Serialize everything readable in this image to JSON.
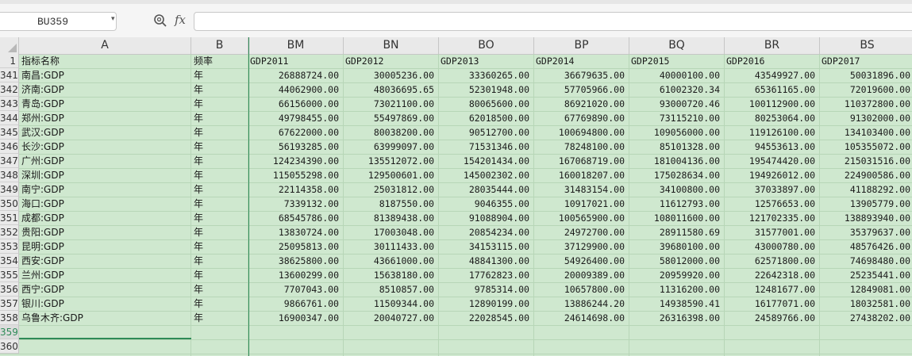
{
  "formula_bar": {
    "name_box": "BU359",
    "fx_label": "fx",
    "formula": ""
  },
  "columns": [
    {
      "id": "A",
      "label": "A",
      "width": 217
    },
    {
      "id": "B",
      "label": "B",
      "width": 72
    },
    {
      "id": "BM",
      "label": "BM",
      "width": 120
    },
    {
      "id": "BN",
      "label": "BN",
      "width": 120
    },
    {
      "id": "BO",
      "label": "BO",
      "width": 120
    },
    {
      "id": "BP",
      "label": "BP",
      "width": 120
    },
    {
      "id": "BQ",
      "label": "BQ",
      "width": 120
    },
    {
      "id": "BR",
      "label": "BR",
      "width": 120
    },
    {
      "id": "BS",
      "label": "BS",
      "width": 120
    }
  ],
  "header_row": {
    "num": "1",
    "cells": [
      "指标名称",
      "频率",
      "GDP2011",
      "GDP2012",
      "GDP2013",
      "GDP2014",
      "GDP2015",
      "GDP2016",
      "GDP2017"
    ]
  },
  "rows": [
    {
      "num": "341",
      "cells": [
        "南昌:GDP",
        "年",
        "26888724.00",
        "30005236.00",
        "33360265.00",
        "36679635.00",
        "40000100.00",
        "43549927.00",
        "50031896.00"
      ]
    },
    {
      "num": "342",
      "cells": [
        "济南:GDP",
        "年",
        "44062900.00",
        "48036695.65",
        "52301948.00",
        "57705966.00",
        "61002320.34",
        "65361165.00",
        "72019600.00"
      ]
    },
    {
      "num": "343",
      "cells": [
        "青岛:GDP",
        "年",
        "66156000.00",
        "73021100.00",
        "80065600.00",
        "86921020.00",
        "93000720.46",
        "100112900.00",
        "110372800.00"
      ]
    },
    {
      "num": "344",
      "cells": [
        "郑州:GDP",
        "年",
        "49798455.00",
        "55497869.00",
        "62018500.00",
        "67769890.00",
        "73115210.00",
        "80253064.00",
        "91302000.00"
      ]
    },
    {
      "num": "345",
      "cells": [
        "武汉:GDP",
        "年",
        "67622000.00",
        "80038200.00",
        "90512700.00",
        "100694800.00",
        "109056000.00",
        "119126100.00",
        "134103400.00"
      ]
    },
    {
      "num": "346",
      "cells": [
        "长沙:GDP",
        "年",
        "56193285.00",
        "63999097.00",
        "71531346.00",
        "78248100.00",
        "85101328.00",
        "94553613.00",
        "105355072.00"
      ]
    },
    {
      "num": "347",
      "cells": [
        "广州:GDP",
        "年",
        "124234390.00",
        "135512072.00",
        "154201434.00",
        "167068719.00",
        "181004136.00",
        "195474420.00",
        "215031516.00"
      ]
    },
    {
      "num": "348",
      "cells": [
        "深圳:GDP",
        "年",
        "115055298.00",
        "129500601.00",
        "145002302.00",
        "160018207.00",
        "175028634.00",
        "194926012.00",
        "224900586.00"
      ]
    },
    {
      "num": "349",
      "cells": [
        "南宁:GDP",
        "年",
        "22114358.00",
        "25031812.00",
        "28035444.00",
        "31483154.00",
        "34100800.00",
        "37033897.00",
        "41188292.00"
      ]
    },
    {
      "num": "350",
      "cells": [
        "海口:GDP",
        "年",
        "7339132.00",
        "8187550.00",
        "9046355.00",
        "10917021.00",
        "11612793.00",
        "12576653.00",
        "13905779.00"
      ]
    },
    {
      "num": "351",
      "cells": [
        "成都:GDP",
        "年",
        "68545786.00",
        "81389438.00",
        "91088904.00",
        "100565900.00",
        "108011600.00",
        "121702335.00",
        "138893940.00"
      ]
    },
    {
      "num": "352",
      "cells": [
        "贵阳:GDP",
        "年",
        "13830724.00",
        "17003048.00",
        "20854234.00",
        "24972700.00",
        "28911580.69",
        "31577001.00",
        "35379637.00"
      ]
    },
    {
      "num": "353",
      "cells": [
        "昆明:GDP",
        "年",
        "25095813.00",
        "30111433.00",
        "34153115.00",
        "37129900.00",
        "39680100.00",
        "43000780.00",
        "48576426.00"
      ]
    },
    {
      "num": "354",
      "cells": [
        "西安:GDP",
        "年",
        "38625800.00",
        "43661000.00",
        "48841300.00",
        "54926400.00",
        "58012000.00",
        "62571800.00",
        "74698480.00"
      ]
    },
    {
      "num": "355",
      "cells": [
        "兰州:GDP",
        "年",
        "13600299.00",
        "15638180.00",
        "17762823.00",
        "20009389.00",
        "20959920.00",
        "22642318.00",
        "25235441.00"
      ]
    },
    {
      "num": "356",
      "cells": [
        "西宁:GDP",
        "年",
        "7707043.00",
        "8510857.00",
        "9785314.00",
        "10657800.00",
        "11316200.00",
        "12481677.00",
        "12849081.00"
      ]
    },
    {
      "num": "357",
      "cells": [
        "银川:GDP",
        "年",
        "9866761.00",
        "11509344.00",
        "12890199.00",
        "13886244.20",
        "14938590.41",
        "16177071.00",
        "18032581.00"
      ]
    },
    {
      "num": "358",
      "cells": [
        "乌鲁木齐:GDP",
        "年",
        "16900347.00",
        "20040727.00",
        "22028545.00",
        "24614698.00",
        "26316398.00",
        "24589766.00",
        "27438202.00"
      ]
    },
    {
      "num": "359",
      "cells": [
        "",
        "",
        "",
        "",
        "",
        "",
        "",
        "",
        ""
      ]
    },
    {
      "num": "360",
      "cells": [
        "",
        "",
        "",
        "",
        "",
        "",
        "",
        "",
        ""
      ]
    }
  ],
  "active_row": "359"
}
